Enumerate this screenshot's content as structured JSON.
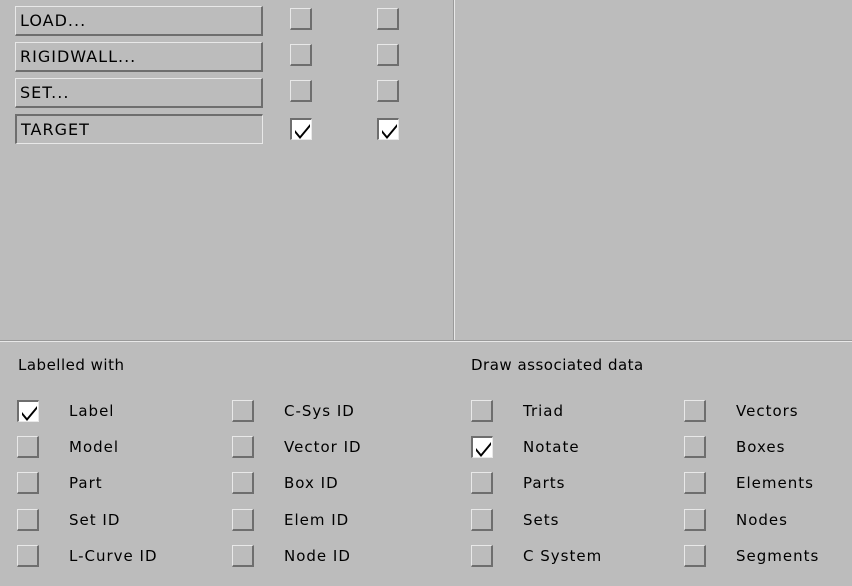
{
  "top_rows": [
    {
      "label": "LOAD...",
      "col1_checked": false,
      "col2_checked": false,
      "active": false
    },
    {
      "label": "RIGIDWALL...",
      "col1_checked": false,
      "col2_checked": false,
      "active": false
    },
    {
      "label": "SET...",
      "col1_checked": false,
      "col2_checked": false,
      "active": false
    },
    {
      "label": "TARGET",
      "col1_checked": true,
      "col2_checked": true,
      "active": true
    }
  ],
  "labelled_with": {
    "title": "Labelled with",
    "col1": [
      {
        "label": "Label",
        "checked": true
      },
      {
        "label": "Model",
        "checked": false
      },
      {
        "label": "Part",
        "checked": false
      },
      {
        "label": "Set ID",
        "checked": false
      },
      {
        "label": "L-Curve ID",
        "checked": false
      }
    ],
    "col2": [
      {
        "label": "C-Sys ID",
        "checked": false
      },
      {
        "label": "Vector ID",
        "checked": false
      },
      {
        "label": "Box ID",
        "checked": false
      },
      {
        "label": "Elem ID",
        "checked": false
      },
      {
        "label": "Node ID",
        "checked": false
      }
    ]
  },
  "draw_associated": {
    "title": "Draw associated data",
    "col1": [
      {
        "label": "Triad",
        "checked": false
      },
      {
        "label": "Notate",
        "checked": true
      },
      {
        "label": "Parts",
        "checked": false
      },
      {
        "label": "Sets",
        "checked": false
      },
      {
        "label": "C System",
        "checked": false
      }
    ],
    "col2": [
      {
        "label": "Vectors",
        "checked": false
      },
      {
        "label": "Boxes",
        "checked": false
      },
      {
        "label": "Elements",
        "checked": false
      },
      {
        "label": "Nodes",
        "checked": false
      },
      {
        "label": "Segments",
        "checked": false
      }
    ]
  }
}
